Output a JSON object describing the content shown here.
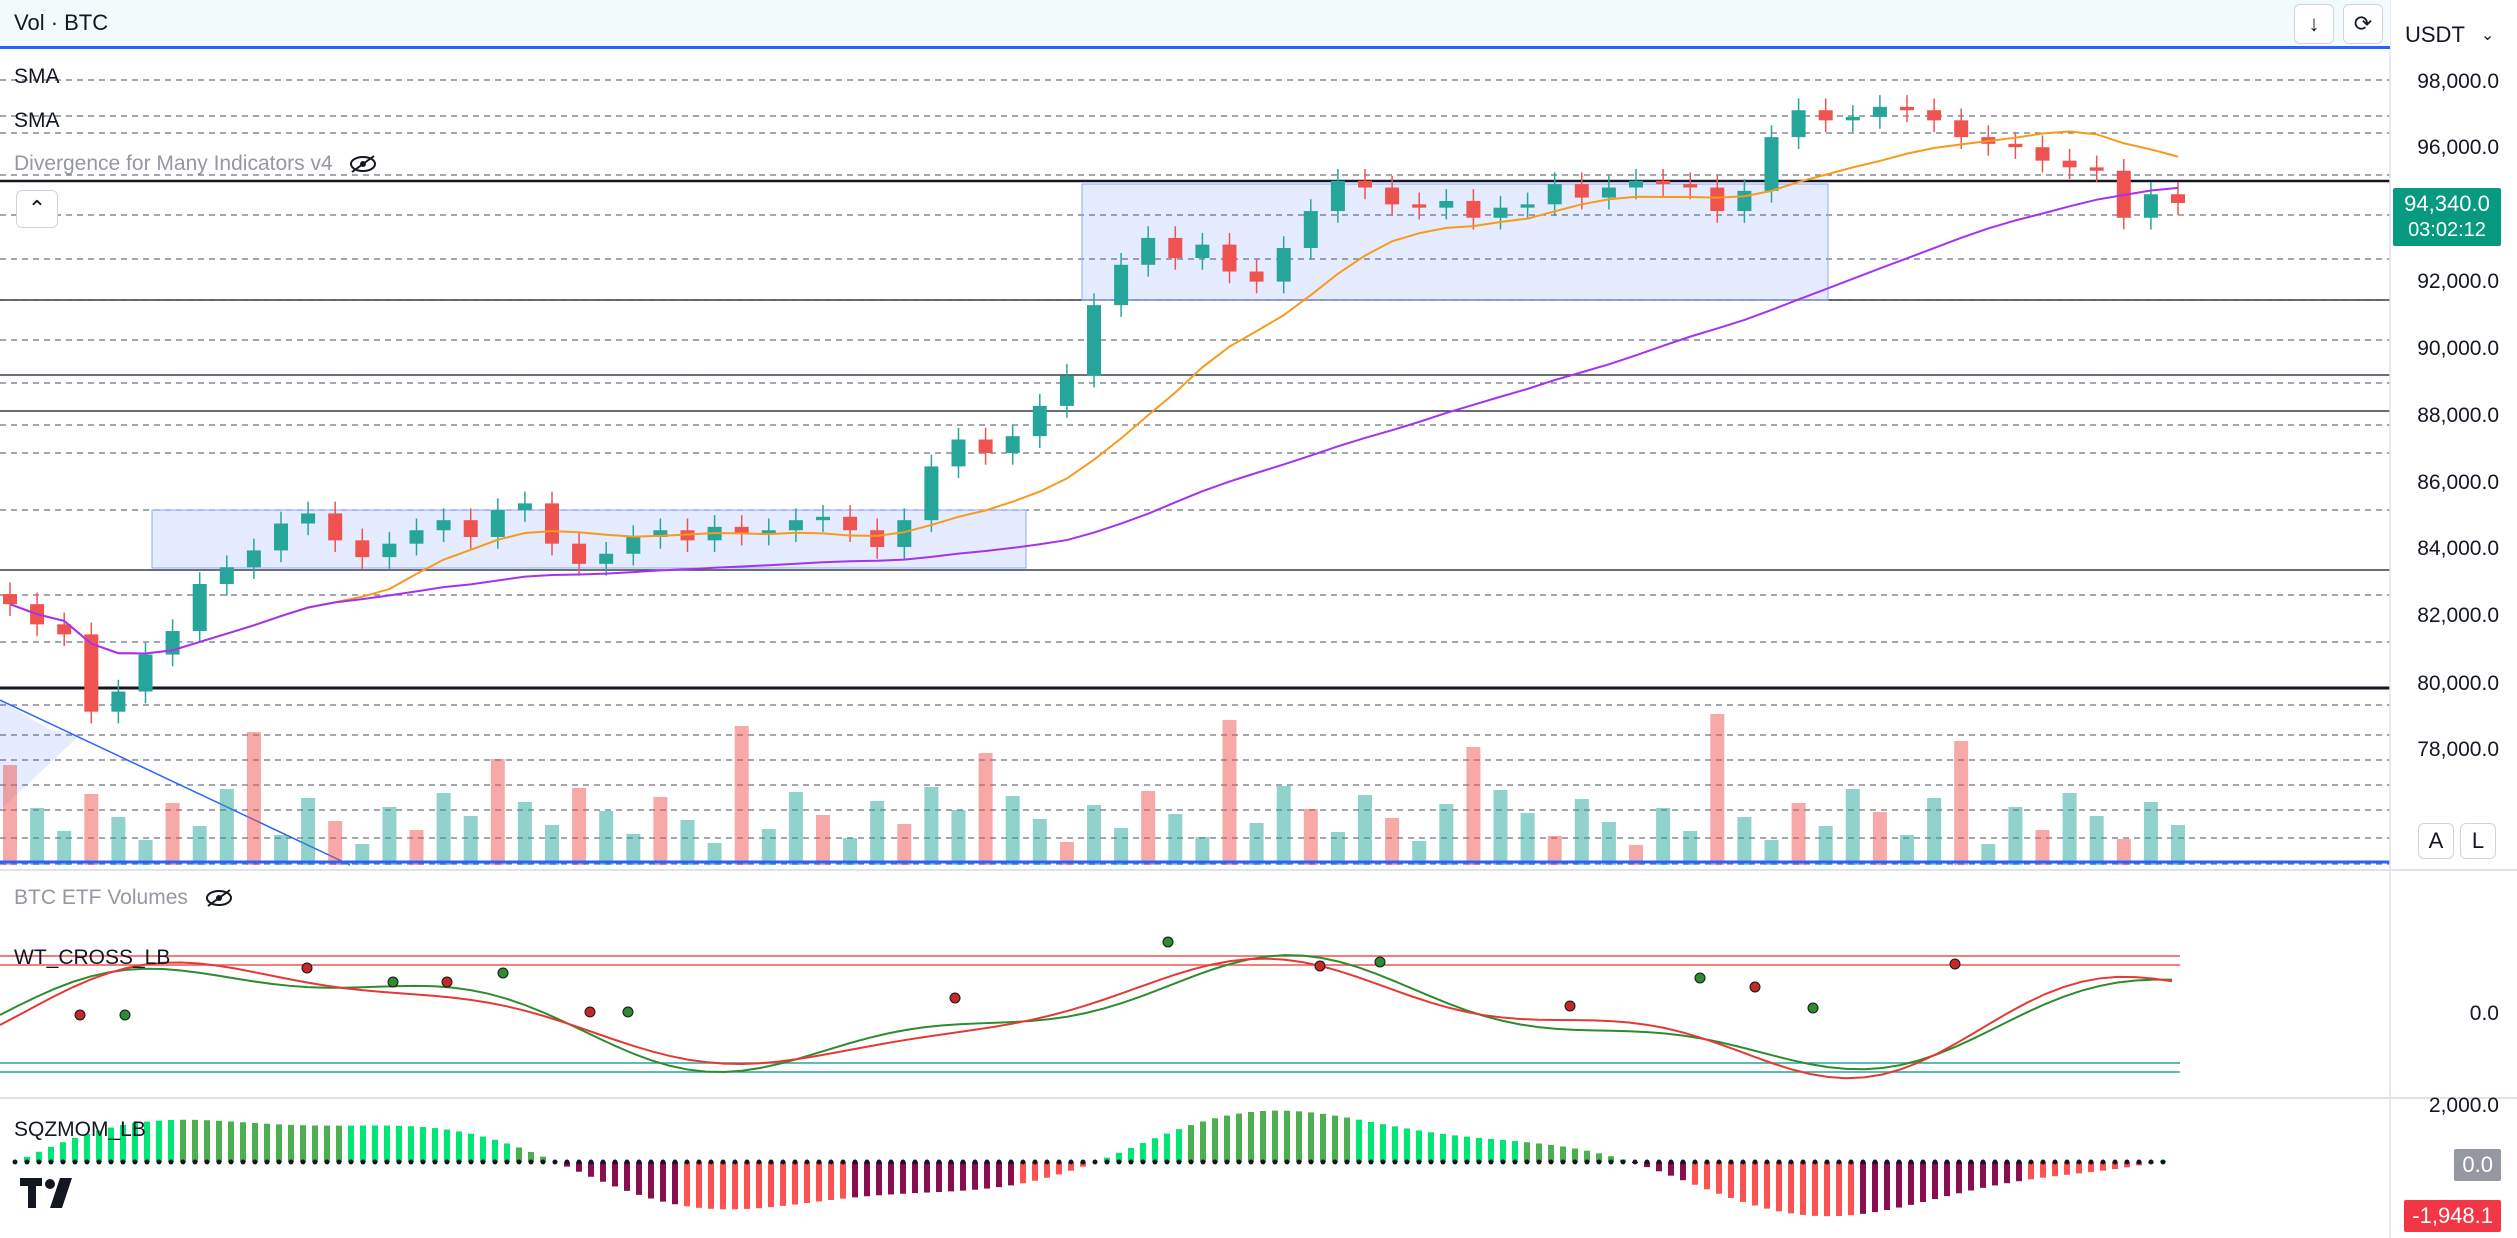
{
  "header": {
    "title": "Vol · BTC",
    "currency": "USDT",
    "buttons": [
      "down-arrow-icon",
      "sync-icon"
    ]
  },
  "indicators": {
    "sma1": "SMA",
    "sma2": "SMA",
    "divergence": "Divergence for Many Indicators v4",
    "etf": "BTC ETF Volumes",
    "wt": "WT_CROSS_LB",
    "sqz": "SQZMOM_LB"
  },
  "price_axis": {
    "labels": [
      "98,000.0",
      "96,000.0",
      "94,340.0",
      "92,000.0",
      "90,000.0",
      "88,000.0",
      "86,000.0",
      "84,000.0",
      "82,000.0",
      "80,000.0",
      "78,000.0"
    ],
    "current_price": "94,340.0",
    "countdown": "03:02:12",
    "scale_buttons": [
      "A",
      "L"
    ]
  },
  "wt_axis": {
    "zero_label": "0.0"
  },
  "sqz_axis": {
    "top_label": "2,000.0",
    "zero_label": "0.0",
    "last_value": "-1,948.1"
  },
  "colors": {
    "up": "#26a69a",
    "down": "#ef5350",
    "sma_fast": "#f89a1c",
    "sma_slow": "#a532f0",
    "accent": "#2962ff"
  },
  "chart_data": {
    "type": "candlestick",
    "y_unit": "USDT",
    "ylim": [
      76500,
      98500
    ],
    "close_series_approx": [
      82400,
      81800,
      81500,
      79200,
      79800,
      80900,
      81600,
      83000,
      83500,
      84000,
      84800,
      85100,
      84300,
      83800,
      84200,
      84600,
      84900,
      84400,
      85200,
      85400,
      84200,
      83600,
      83900,
      84400,
      84600,
      84300,
      84700,
      84500,
      84600,
      84900,
      85000,
      84600,
      84100,
      84900,
      86500,
      87300,
      86900,
      87400,
      88300,
      89200,
      91300,
      92500,
      93300,
      92700,
      93100,
      92300,
      92000,
      93000,
      94100,
      95000,
      94800,
      94300,
      94200,
      94400,
      93900,
      94200,
      94300,
      94900,
      94500,
      94800,
      95000,
      94900,
      94800,
      94100,
      94700,
      96300,
      97100,
      96800,
      96900,
      97200,
      97100,
      96800,
      96300,
      96100,
      96000,
      95600,
      95400,
      95300,
      93900,
      94600,
      94340
    ],
    "annotations": [
      "current price 94,340.0",
      "time to close 03:02:12"
    ]
  }
}
